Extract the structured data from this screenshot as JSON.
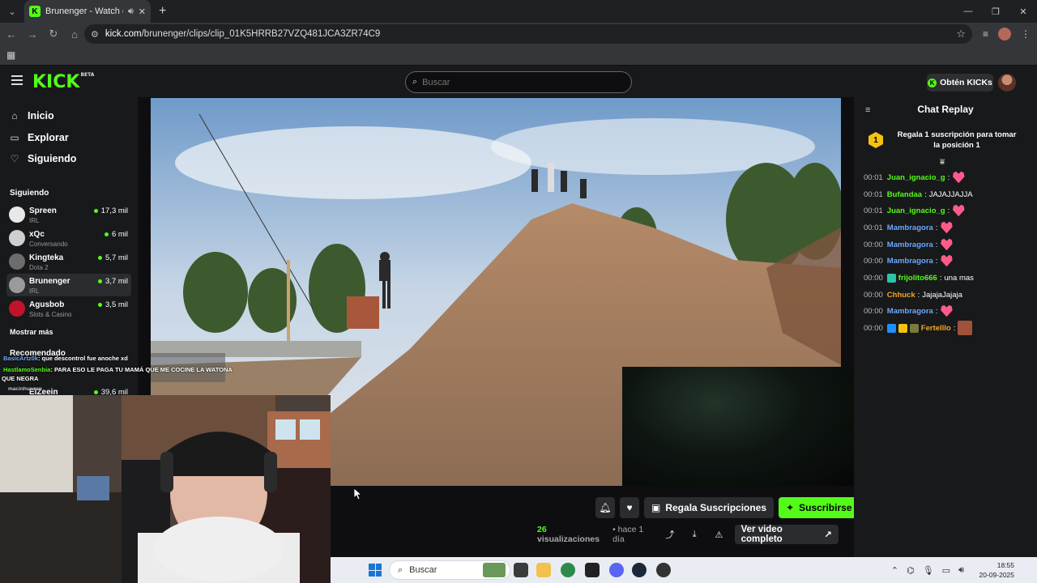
{
  "browser": {
    "tab_title": "Brunenger - Watch clips on Kick",
    "url_host": "kick.com",
    "url_path": "/brunenger/clips/clip_01K5HRRB27VZQ481JCA3ZR74C9"
  },
  "header": {
    "logo": "KICK",
    "logo_badge": "BETA",
    "search_placeholder": "Buscar",
    "kicks_label": "Obtén KICKs"
  },
  "sidebar": {
    "nav": [
      {
        "label": "Inicio",
        "icon": "home-icon"
      },
      {
        "label": "Explorar",
        "icon": "compass-icon"
      },
      {
        "label": "Siguiendo",
        "icon": "heart-icon"
      }
    ],
    "following_title": "Siguiendo",
    "channels": [
      {
        "name": "Spreen",
        "category": "IRL",
        "viewers": "17,3 mil",
        "avatar_color": "#e8e8e8"
      },
      {
        "name": "xQc",
        "category": "Conversando",
        "viewers": "6 mil",
        "avatar_color": "#cfcfcf"
      },
      {
        "name": "Kingteka",
        "category": "Dota 2",
        "viewers": "5,7 mil",
        "avatar_color": "#6d6d6d"
      },
      {
        "name": "Brunenger",
        "category": "IRL",
        "viewers": "3,7 mil",
        "avatar_color": "#9a9a9a"
      },
      {
        "name": "Agusbob",
        "category": "Slots & Casino",
        "viewers": "3,5 mil",
        "avatar_color": "#c0142c"
      }
    ],
    "show_more": "Mostrar más",
    "recommended_title": "Recomendado",
    "recommended_channel": "ElZeein",
    "recommended_viewers": "39,6 mil"
  },
  "overlay_chat": [
    {
      "user": "BasicArtz0k",
      "text": ": que descontrol fue anoche xd"
    },
    {
      "user": "HastlamoSenbia",
      "text": ": PARA ESO LE PAGA TU MAMÁ QUE ME COCINE LA WATONA"
    },
    {
      "user": "",
      "text": "QUE NEGRA"
    },
    {
      "user": "macinhuwrap",
      "text": ""
    }
  ],
  "actions": {
    "gift_label": "Regala Suscripciones",
    "subscribe_label": "Suscribirse",
    "views_count": "26",
    "views_label": "visualizaciones",
    "time_ago": "• hace 1 día",
    "full_video_label": "Ver video completo"
  },
  "chat": {
    "title": "Chat Replay",
    "gift_rank": "1",
    "gift_text": "Regala 1 suscripción para tomar la posición 1",
    "messages": [
      {
        "time": "00:01",
        "user": "Juan_ignacio_g",
        "color": "#53fc18",
        "text": "",
        "emote": true
      },
      {
        "time": "00:01",
        "user": "Bufandaa",
        "color": "#53fc18",
        "text": " JAJAJJAJJA",
        "emote": false
      },
      {
        "time": "00:01",
        "user": "Juan_ignacio_g",
        "color": "#53fc18",
        "text": "",
        "emote": true
      },
      {
        "time": "00:01",
        "user": "Mambragora",
        "color": "#6aa9ff",
        "text": "",
        "emote": true
      },
      {
        "time": "00:00",
        "user": "Mambragora",
        "color": "#6aa9ff",
        "text": "",
        "emote": true
      },
      {
        "time": "00:00",
        "user": "Mambragora",
        "color": "#6aa9ff",
        "text": "",
        "emote": true
      },
      {
        "time": "00:00",
        "user": "frijolito666",
        "color": "#53fc18",
        "text": " una mas",
        "emote": false
      },
      {
        "time": "00:00",
        "user": "Chhuck",
        "color": "#f5a623",
        "text": " JajajaJajaja",
        "emote": false
      },
      {
        "time": "00:00",
        "user": "Mambragora",
        "color": "#6aa9ff",
        "text": "",
        "emote": true
      },
      {
        "time": "00:00",
        "user": "Fertelllo",
        "color": "#f5a623",
        "text": "",
        "emote": false
      }
    ]
  },
  "taskbar": {
    "search_label": "Buscar",
    "time": "18:55",
    "date": "20-09-2025"
  }
}
